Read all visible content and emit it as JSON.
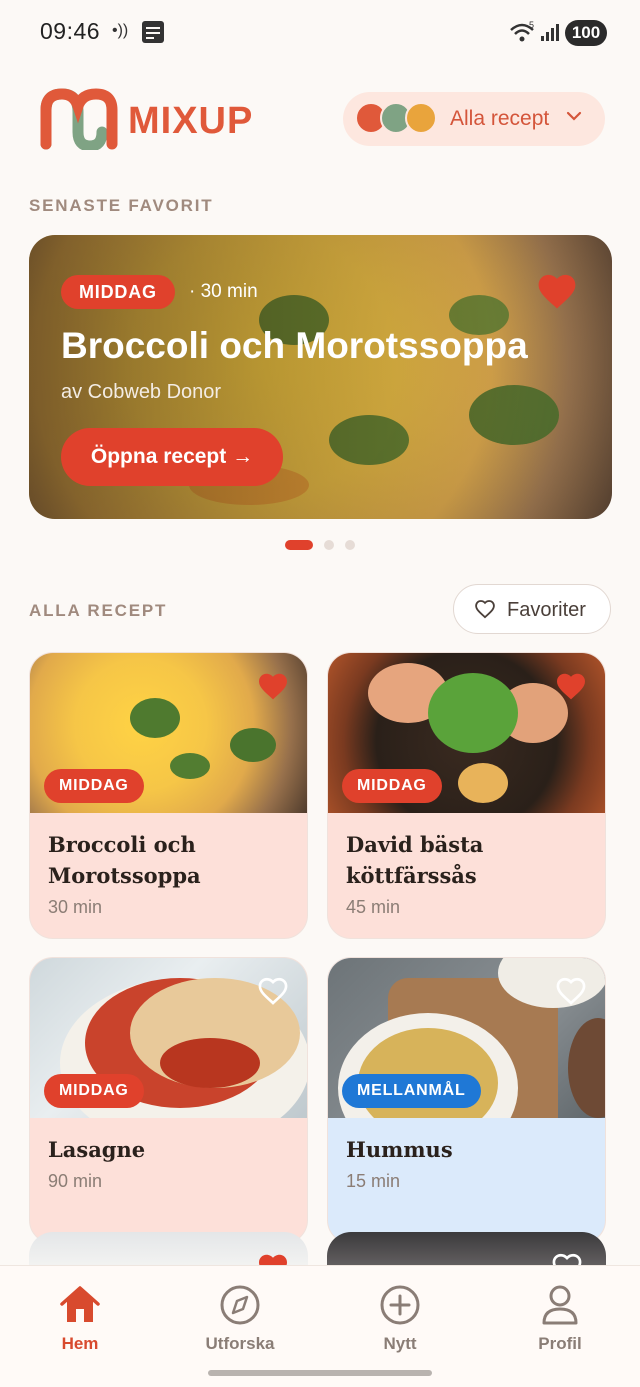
{
  "status_bar": {
    "time": "09:46",
    "nfc": "•))",
    "wifi_label": "5",
    "battery": "100"
  },
  "header": {
    "brand": "MIXUP",
    "filter_label": "Alla recept",
    "filter_dot_colors": [
      "#e0593a",
      "#7fa384",
      "#e9a43c"
    ]
  },
  "favorites_section": {
    "title": "SENASTE FAVORIT",
    "hero": {
      "tag": "MIDDAG",
      "duration": "· 30 min",
      "title": "Broccoli och Morotssoppa",
      "author": "av Cobweb Donor",
      "open_button": "Öppna recept →",
      "favorited": true
    },
    "pager": {
      "count": 3,
      "active_index": 0
    }
  },
  "recipes_section": {
    "title": "ALLA RECEPT",
    "favorites_button": "Favoriter",
    "cards": [
      {
        "tag": "MIDDAG",
        "tag_color": "#e0412c",
        "title": "Broccoli och Morotssoppa",
        "duration": "30 min",
        "favorited": true,
        "bg": "#fde0d9",
        "image": "soup"
      },
      {
        "tag": "MIDDAG",
        "tag_color": "#e0412c",
        "title": "David bästa köttfärssås",
        "duration": "45 min",
        "favorited": true,
        "bg": "#fde0d9",
        "image": "ramen"
      },
      {
        "tag": "MIDDAG",
        "tag_color": "#e0412c",
        "title": "Lasagne",
        "duration": "90 min",
        "favorited": false,
        "bg": "#fde0d9",
        "image": "lasagne"
      },
      {
        "tag": "MELLANMÅL",
        "tag_color": "#1f78d6",
        "title": "Hummus",
        "duration": "15 min",
        "favorited": false,
        "bg": "#dbeafb",
        "image": "bowls"
      }
    ]
  },
  "bottom_nav": {
    "items": [
      {
        "label": "Hem",
        "icon": "home-icon",
        "active": true
      },
      {
        "label": "Utforska",
        "icon": "compass-icon",
        "active": false
      },
      {
        "label": "Nytt",
        "icon": "plus-circle-icon",
        "active": false
      },
      {
        "label": "Profil",
        "icon": "person-icon",
        "active": false
      }
    ]
  },
  "colors": {
    "accent": "#e0412c",
    "brand": "#e0593a",
    "background": "#fcf9f6"
  }
}
